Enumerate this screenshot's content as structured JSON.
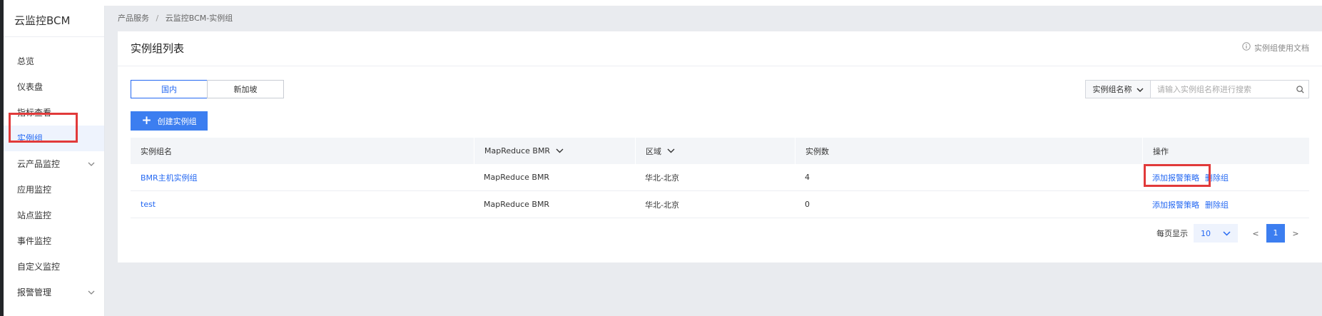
{
  "sidebar": {
    "title": "云监控BCM",
    "items": [
      {
        "label": "总览"
      },
      {
        "label": "仪表盘"
      },
      {
        "label": "指标查看"
      },
      {
        "label": "实例组"
      },
      {
        "label": "云产品监控"
      },
      {
        "label": "应用监控"
      },
      {
        "label": "站点监控"
      },
      {
        "label": "事件监控"
      },
      {
        "label": "自定义监控"
      },
      {
        "label": "报警管理"
      }
    ]
  },
  "breadcrumb": {
    "items": [
      "产品服务",
      "云监控BCM-实例组"
    ],
    "separator": "/"
  },
  "card": {
    "title": "实例组列表",
    "doc_link": "实例组使用文档",
    "region_tabs": [
      "国内",
      "新加坡"
    ],
    "search": {
      "select_label": "实例组名称",
      "placeholder": "请输入实例组名称进行搜索"
    },
    "create_button": "创建实例组"
  },
  "table": {
    "headers": [
      "实例组名",
      "MapReduce BMR",
      "区域",
      "实例数",
      "操作"
    ],
    "rows": [
      {
        "name": "BMR主机实例组",
        "product": "MapReduce BMR",
        "region": "华北-北京",
        "count": "4",
        "actions": [
          "添加报警策略",
          "删除组"
        ]
      },
      {
        "name": "test",
        "product": "MapReduce BMR",
        "region": "华北-北京",
        "count": "0",
        "actions": [
          "添加报警策略",
          "删除组"
        ]
      }
    ]
  },
  "pagination": {
    "page_size_label": "每页显示",
    "page_size": "10",
    "prev": "<",
    "current_page": "1",
    "next": ">"
  },
  "colors": {
    "accent": "#2468f2",
    "button": "#3c7ef0",
    "highlight": "#e13a3a",
    "background": "#e9ebef"
  }
}
